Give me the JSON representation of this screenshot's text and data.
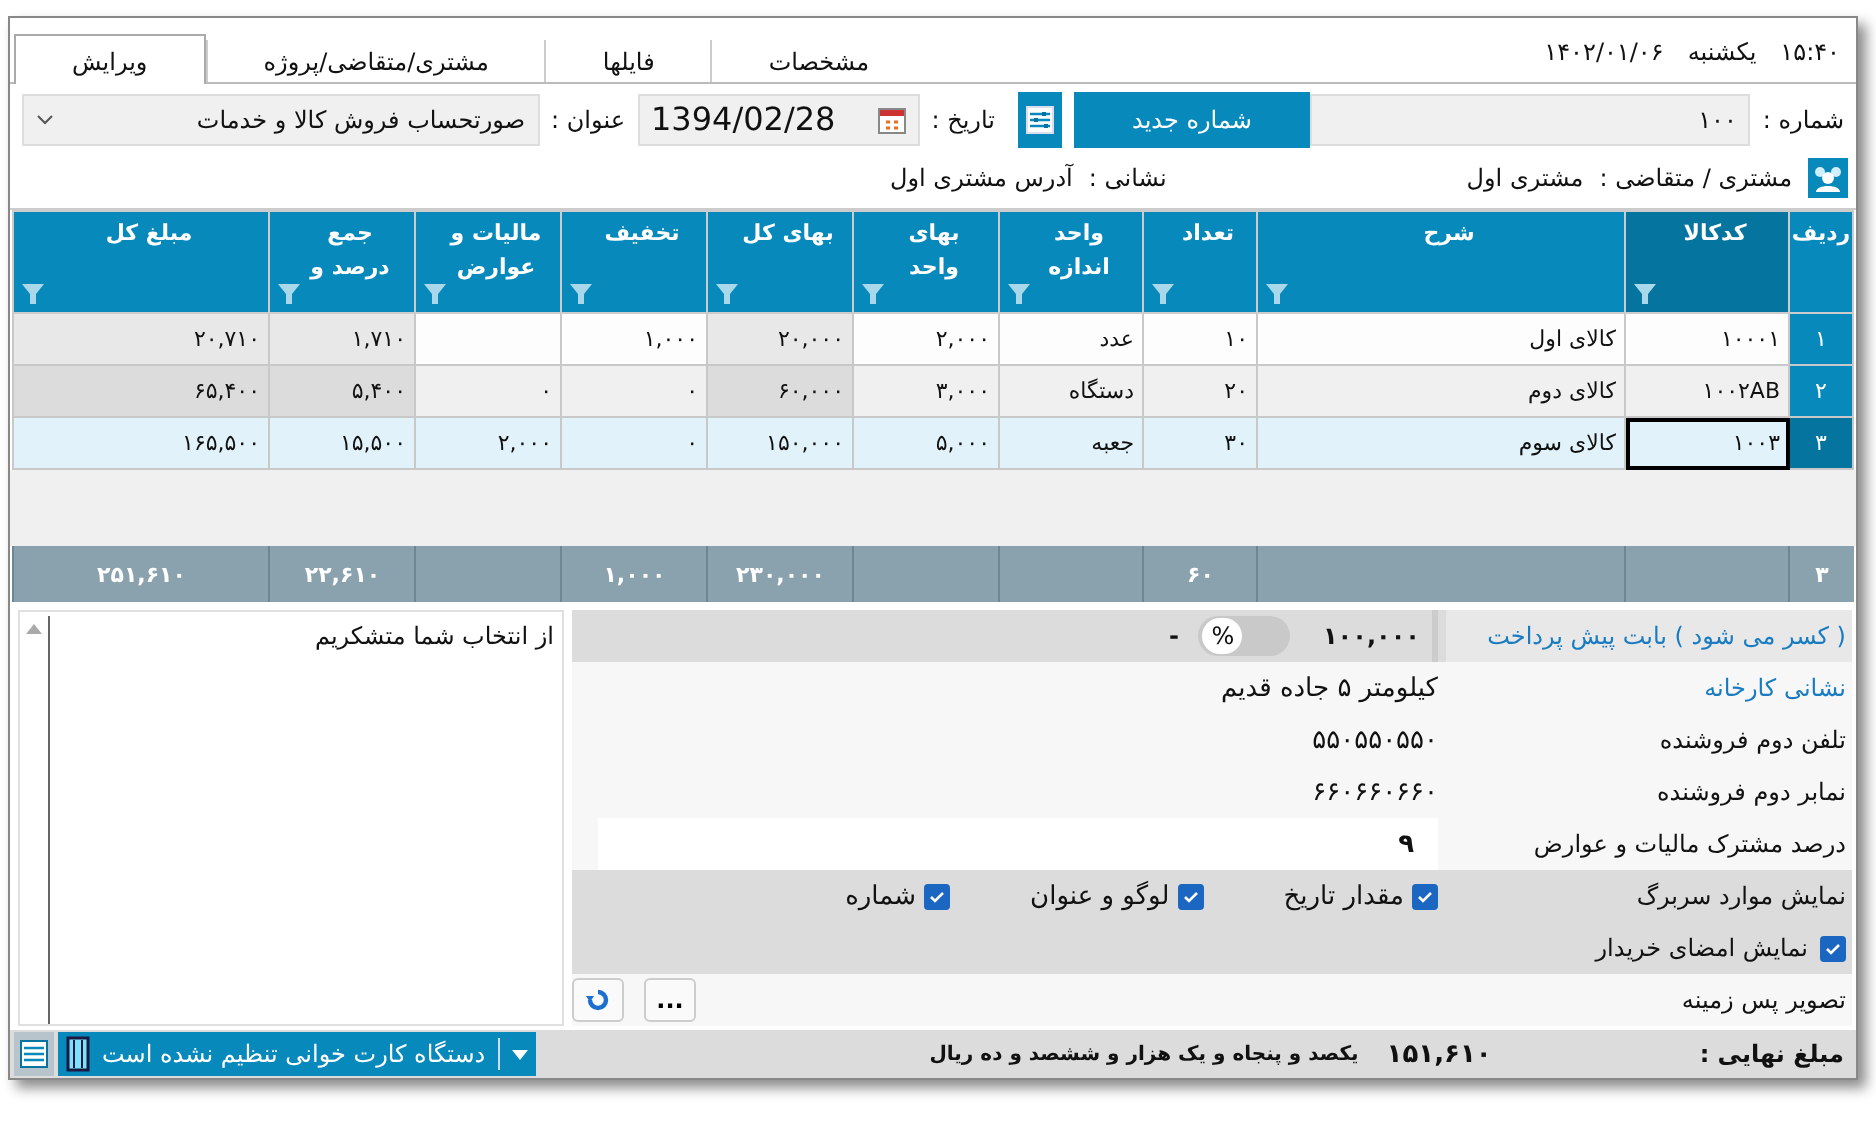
{
  "header": {
    "time": "۱۵:۴۰",
    "weekday": "یکشنبه",
    "date": "۱۴۰۲/۰۱/۰۶"
  },
  "tabs": [
    {
      "label": "مشخصات",
      "selected": false
    },
    {
      "label": "فایلها",
      "selected": false
    },
    {
      "label": "مشتری/متقاضی/پروژه",
      "selected": false
    },
    {
      "label": "ویرایش",
      "selected": true
    }
  ],
  "number": {
    "label": "شماره :",
    "value": "۱۰۰",
    "new_button": "شماره جدید"
  },
  "date": {
    "label": "تاریخ :",
    "value": "1394/02/28"
  },
  "title": {
    "label": "عنوان :",
    "value": "صورتحساب فروش کالا و خدمات"
  },
  "customer": {
    "label": "مشتری / متقاضی :",
    "value": "مشتری اول",
    "address_label": "نشانی :",
    "address": "آدرس مشتری اول"
  },
  "table": {
    "columns": [
      {
        "label": "ردیف",
        "filter": false,
        "selected": false
      },
      {
        "label": "کدکالا",
        "filter": true,
        "selected": true,
        "computed": false
      },
      {
        "label": "شرح",
        "filter": true,
        "selected": false,
        "computed": false
      },
      {
        "label": "تعداد",
        "filter": true,
        "selected": false,
        "computed": false
      },
      {
        "label": "واحد اندازه",
        "filter": true,
        "selected": false,
        "computed": false
      },
      {
        "label": "بهای واحد",
        "filter": true,
        "selected": false,
        "computed": false
      },
      {
        "label": "بهای کل",
        "filter": true,
        "selected": false,
        "computed": true
      },
      {
        "label": "تخفیف",
        "filter": true,
        "selected": false,
        "computed": false
      },
      {
        "label": "مالیات و عوارض",
        "filter": true,
        "selected": false,
        "computed": false
      },
      {
        "label": "جمع درصد و",
        "filter": true,
        "selected": false,
        "computed": true
      },
      {
        "label": "مبلغ کل",
        "filter": true,
        "selected": false,
        "computed": true
      }
    ],
    "rows": [
      {
        "selected": false,
        "focused": false,
        "cells": [
          "۱",
          "۱۰۰۰۱",
          "کالای اول",
          "۱۰",
          "عدد",
          "۲,۰۰۰",
          "۲۰,۰۰۰",
          "۱,۰۰۰",
          null,
          "۱,۷۱۰",
          "۲۰,۷۱۰"
        ]
      },
      {
        "selected": false,
        "focused": false,
        "cells": [
          "۲",
          "۱۰۰۲AB",
          "کالای دوم",
          "۲۰",
          "دستگاه",
          "۳,۰۰۰",
          "۶۰,۰۰۰",
          "۰",
          "۰",
          "۵,۴۰۰",
          "۶۵,۴۰۰"
        ]
      },
      {
        "selected": true,
        "focused": true,
        "cells": [
          "۳",
          "۱۰۰۳",
          "کالای سوم",
          "۳۰",
          "جعبه",
          "۵,۰۰۰",
          "۱۵۰,۰۰۰",
          "۰",
          "۲,۰۰۰",
          "۱۵,۵۰۰",
          "۱۶۵,۵۰۰"
        ]
      }
    ]
  },
  "table_totals": {
    "row_count": "۳",
    "quantity": "۶۰",
    "total_price": "۲۳۰,۰۰۰",
    "discount": "۱,۰۰۰",
    "sum": "۲۲,۶۱۰",
    "amount": "۲۵۱,۶۱۰"
  },
  "notes": "از انتخاب شما متشکریم",
  "form": [
    {
      "kind": "prepay",
      "label": "( کسر می شود ) بابت پیش پرداخت",
      "accent": true,
      "value": "۱۰۰,۰۰۰",
      "toggle_label": "%",
      "percent": false,
      "sign": "-"
    },
    {
      "kind": "text",
      "label": "نشانی کارخانه",
      "accent": true,
      "value": "کیلومتر ۵ جاده قدیم"
    },
    {
      "kind": "text",
      "label": "تلفن دوم فروشنده",
      "accent": false,
      "value": "۵۵۰۵۵۰۵۵۰"
    },
    {
      "kind": "text",
      "label": "نمابر دوم فروشنده",
      "accent": false,
      "value": "۶۶۰۶۶۰۶۶۰"
    },
    {
      "kind": "input",
      "label": "درصد مشترک مالیات و عوارض",
      "accent": false,
      "value": "۹"
    },
    {
      "kind": "checks",
      "label": "نمایش موارد سربرگ",
      "accent": false,
      "items": [
        {
          "label": "مقدار تاریخ",
          "checked": true
        },
        {
          "label": "لوگو و عنوان",
          "checked": true
        },
        {
          "label": "شماره",
          "checked": true
        }
      ]
    },
    {
      "kind": "checkbox",
      "label": "نمایش امضای خریدار",
      "accent": false,
      "checked": true
    },
    {
      "kind": "file",
      "label": "تصویر پس زمینه",
      "accent": false,
      "browse": "..."
    }
  ],
  "status_bar": {
    "total_label": "مبلغ نهایی :",
    "total": "۱۵۱,۶۱۰",
    "total_words": "یکصد و پنجاه و یک هزار و ششصد و ده ریال",
    "card_reader": "دستگاه کارت خوانی تنظیم نشده است"
  }
}
